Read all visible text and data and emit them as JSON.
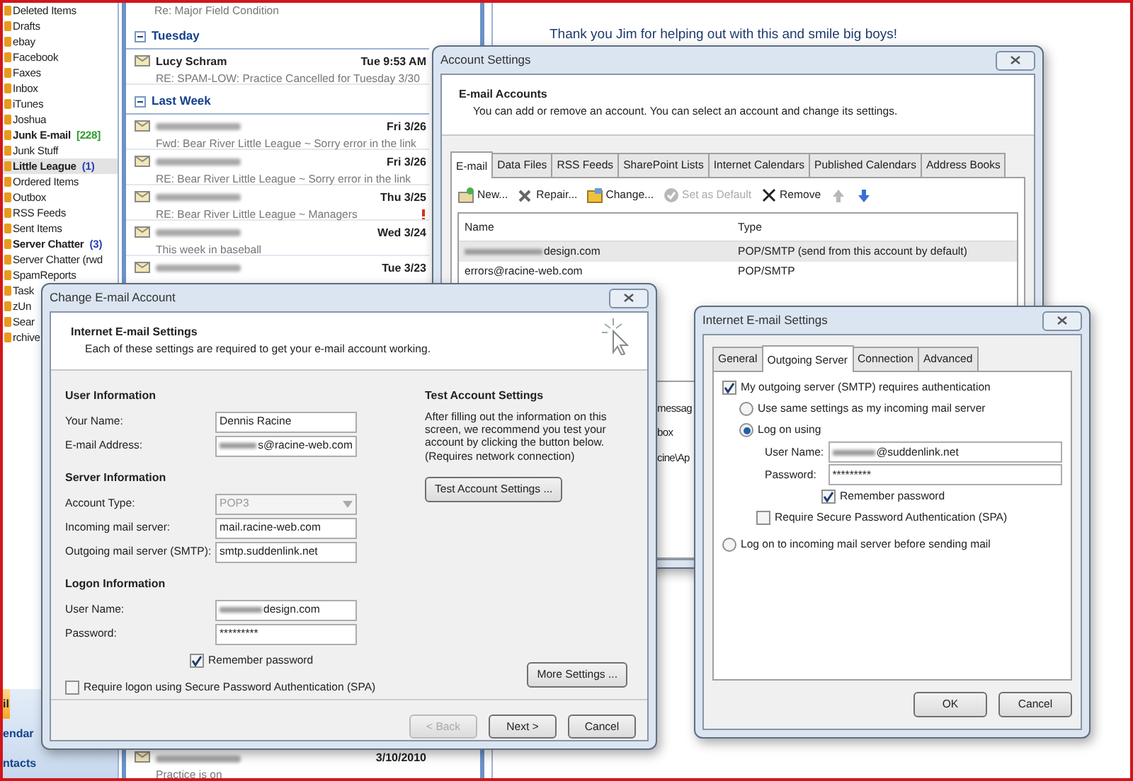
{
  "folder_pane": {
    "folders": [
      {
        "name": "Deleted Items",
        "unread": false,
        "selected": false
      },
      {
        "name": "Drafts",
        "unread": false,
        "selected": false
      },
      {
        "name": "ebay",
        "unread": false,
        "selected": false
      },
      {
        "name": "Facebook",
        "unread": false,
        "selected": false
      },
      {
        "name": "Faxes",
        "unread": false,
        "selected": false
      },
      {
        "name": "Inbox",
        "unread": false,
        "selected": false
      },
      {
        "name": "iTunes",
        "unread": false,
        "selected": false
      },
      {
        "name": "Joshua",
        "unread": false,
        "selected": false
      },
      {
        "name": "Junk E-mail",
        "unread": true,
        "selected": false,
        "count": {
          "text": "[228]",
          "color": "#2e9a2e"
        }
      },
      {
        "name": "Junk Stuff",
        "unread": false,
        "selected": false
      },
      {
        "name": "Little League",
        "unread": true,
        "selected": true,
        "count": {
          "text": "(1)",
          "color": "#2b3fb0"
        }
      },
      {
        "name": "Ordered Items",
        "unread": false,
        "selected": false
      },
      {
        "name": "Outbox",
        "unread": false,
        "selected": false
      },
      {
        "name": "RSS Feeds",
        "unread": false,
        "selected": false
      },
      {
        "name": "Sent Items",
        "unread": false,
        "selected": false
      },
      {
        "name": "Server Chatter",
        "unread": true,
        "selected": false,
        "count": {
          "text": "(3)",
          "color": "#2b3fb0"
        }
      },
      {
        "name": "Server Chatter (rwd",
        "unread": false,
        "selected": false
      },
      {
        "name": "SpamReports",
        "unread": false,
        "selected": false
      },
      {
        "name": "Task",
        "unread": false,
        "selected": false
      },
      {
        "name": "zUn",
        "unread": false,
        "selected": false
      },
      {
        "name": "Sear",
        "unread": false,
        "selected": false
      },
      {
        "name": "rchive",
        "unread": false,
        "selected": false
      }
    ],
    "nav_buttons": [
      {
        "label": "il",
        "selected": true
      },
      {
        "label": "endar",
        "selected": false
      },
      {
        "label": "ntacts",
        "selected": false
      }
    ]
  },
  "message_list": {
    "items": [
      {
        "kind": "subject",
        "subject": "Re: Major Field Condition"
      },
      {
        "kind": "group",
        "label": "Tuesday"
      },
      {
        "kind": "message",
        "sender": "Lucy Schram",
        "date": "Tue 9:53 AM",
        "subject": "RE: SPAM-LOW:  Practice Cancelled for Tuesday 3/30",
        "flagged": false
      },
      {
        "kind": "group",
        "label": "Last Week"
      },
      {
        "kind": "message",
        "date": "Fri 3/26",
        "subject": "Fwd: Bear River Little League ~ Sorry error in the link",
        "flagged": false
      },
      {
        "kind": "message",
        "date": "Fri 3/26",
        "subject": "RE: Bear River Little League ~ Sorry error in the link",
        "flagged": false
      },
      {
        "kind": "message",
        "date": "Thu 3/25",
        "subject": "RE: Bear River Little League ~ Managers",
        "flagged": true
      },
      {
        "kind": "message",
        "date": "Wed 3/24",
        "subject": "This week in baseball",
        "flagged": false
      },
      {
        "kind": "message",
        "date": "Tue 3/23",
        "flagged": false
      }
    ],
    "bottom_message": {
      "date": "3/10/2010",
      "subject": "Practice is on"
    }
  },
  "reading_pane": {
    "text": "Thank you Jim for helping out with this and smile big boys!"
  },
  "account_settings": {
    "title": "Account Settings",
    "heading": "E-mail Accounts",
    "subheading": "You can add or remove an account. You can select an account and change its settings.",
    "tabs": [
      {
        "label": "E-mail",
        "selected": true
      },
      {
        "label": "Data Files",
        "selected": false
      },
      {
        "label": "RSS Feeds",
        "selected": false
      },
      {
        "label": "SharePoint Lists",
        "selected": false
      },
      {
        "label": "Internet Calendars",
        "selected": false
      },
      {
        "label": "Published Calendars",
        "selected": false
      },
      {
        "label": "Address Books",
        "selected": false
      }
    ],
    "toolbar": [
      {
        "kind": "new",
        "label": "New...",
        "disabled": false
      },
      {
        "kind": "repair",
        "label": "Repair...",
        "disabled": false
      },
      {
        "kind": "change",
        "label": "Change...",
        "disabled": false
      },
      {
        "kind": "default",
        "label": "Set as Default",
        "disabled": true
      },
      {
        "kind": "remove",
        "label": "Remove",
        "disabled": false
      },
      {
        "kind": "up",
        "disabled": true
      },
      {
        "kind": "down",
        "disabled": false
      }
    ],
    "columns": [
      "Name",
      "Type"
    ],
    "rows": [
      {
        "name": "design.com",
        "redacted_prefix": true,
        "type": "POP/SMTP (send from this account by default)",
        "selected": true
      },
      {
        "name": "errors@racine-web.com",
        "redacted_prefix": false,
        "type": "POP/SMTP",
        "selected": false
      }
    ],
    "fragments": [
      "messag",
      "box",
      "cine\\Ap"
    ]
  },
  "change_account": {
    "title": "Change E-mail Account",
    "heading": "Internet E-mail Settings",
    "subheading": "Each of these settings are required to get your e-mail account working.",
    "sections": [
      {
        "title": "User Information",
        "fields": [
          {
            "kind": "text",
            "label": "Your Name:",
            "value": "Dennis Racine",
            "redacted_prefix": false
          },
          {
            "kind": "text",
            "label": "E-mail Address:",
            "value": "s@racine-web.com",
            "redacted_prefix": true
          }
        ]
      },
      {
        "title": "Server Information",
        "fields": [
          {
            "kind": "dropdown",
            "label": "Account Type:",
            "value": "POP3",
            "redacted_prefix": false,
            "disabled": true
          },
          {
            "kind": "text",
            "label": "Incoming mail server:",
            "value": "mail.racine-web.com",
            "redacted_prefix": false
          },
          {
            "kind": "text",
            "label": "Outgoing mail server (SMTP):",
            "value": "smtp.suddenlink.net",
            "redacted_prefix": false
          }
        ]
      },
      {
        "title": "Logon Information",
        "fields": [
          {
            "kind": "text",
            "label": "User Name:",
            "value": "design.com",
            "redacted_prefix": true
          },
          {
            "kind": "text",
            "label": "Password:",
            "value": "*********",
            "redacted_prefix": false
          }
        ]
      }
    ],
    "remember_password": {
      "label": "Remember password",
      "checked": true
    },
    "require_spa": {
      "label": "Require logon using Secure Password Authentication (SPA)",
      "checked": false
    },
    "test": {
      "title": "Test Account Settings",
      "text": "After filling out the information on this screen, we recommend you test your account by clicking the button below. (Requires network connection)",
      "button": "Test Account Settings ..."
    },
    "more_settings": "More Settings ...",
    "buttons": [
      {
        "label": "< Back",
        "disabled": true
      },
      {
        "label": "Next >",
        "disabled": false
      },
      {
        "label": "Cancel",
        "disabled": false
      }
    ]
  },
  "internet_settings": {
    "title": "Internet E-mail Settings",
    "tabs": [
      {
        "label": "General",
        "selected": false
      },
      {
        "label": "Outgoing Server",
        "selected": true
      },
      {
        "label": "Connection",
        "selected": false
      },
      {
        "label": "Advanced",
        "selected": false
      }
    ],
    "options": [
      {
        "kind": "checkbox",
        "label": "My outgoing server (SMTP) requires authentication",
        "checked": true,
        "children": [
          {
            "kind": "radio",
            "label": "Use same settings as my incoming mail server",
            "selected": false
          },
          {
            "kind": "radio",
            "label": "Log on using",
            "selected": true,
            "children": [
              {
                "kind": "field",
                "label": "User Name:",
                "value": "@suddenlink.net",
                "redacted_prefix": true
              },
              {
                "kind": "field",
                "label": "Password:",
                "value": "*********",
                "redacted_prefix": false
              },
              {
                "kind": "field_checkbox",
                "label": "Remember password",
                "checked": true
              },
              {
                "kind": "checkbox",
                "label": "Require Secure Password Authentication (SPA)",
                "checked": false
              }
            ]
          }
        ]
      },
      {
        "kind": "radio",
        "label": "Log on to incoming mail server before sending mail",
        "selected": false
      }
    ],
    "buttons": [
      "OK",
      "Cancel"
    ]
  }
}
